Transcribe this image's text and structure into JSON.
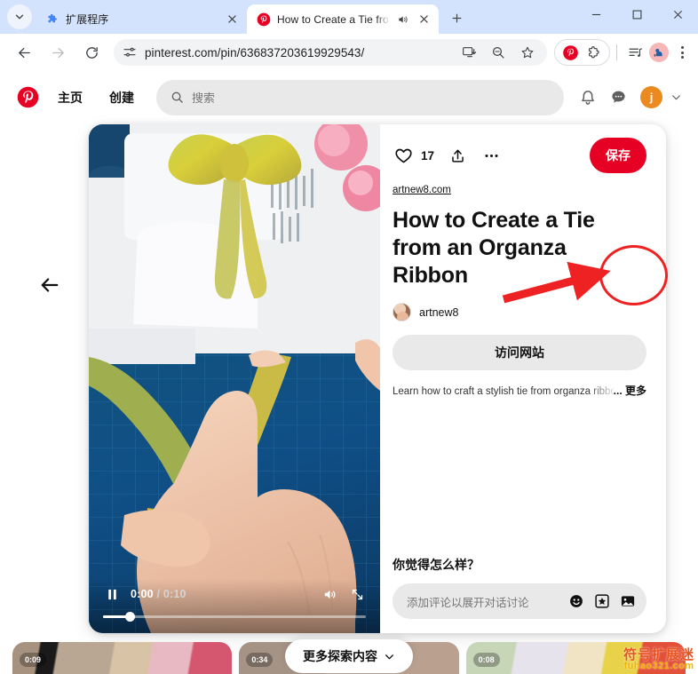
{
  "browser": {
    "tabs": [
      {
        "title": "扩展程序",
        "favicon": "puzzle-icon",
        "active": false,
        "audio": false
      },
      {
        "title": "How to Create a Tie from",
        "favicon": "pinterest-icon",
        "active": true,
        "audio": true
      }
    ],
    "new_tab_label": "+",
    "url": "pinterest.com/pin/636837203619929543/",
    "nav": {
      "back": "back-arrow-icon",
      "forward": "forward-arrow-icon",
      "reload": "reload-icon"
    },
    "omnibox_icons": [
      "site-settings-icon",
      "install-app-icon",
      "zoom-icon",
      "bookmark-star-icon"
    ],
    "extensions": [
      "pinterest-extension-icon",
      "extensions-puzzle-icon"
    ],
    "toolbar_icons": [
      "reading-list-icon",
      "profile-avatar-icon",
      "chrome-menu-icon"
    ],
    "window_controls": [
      "minimize",
      "maximize",
      "close"
    ]
  },
  "pinterest": {
    "logo": "pinterest-logo-icon",
    "nav": [
      {
        "label": "主页"
      },
      {
        "label": "创建"
      }
    ],
    "search": {
      "placeholder": "搜索",
      "icon": "search-icon"
    },
    "header_icons": [
      "notifications-bell-icon",
      "messages-icon"
    ],
    "account": {
      "initial": "j",
      "color": "#eb8a1e"
    },
    "back_arrow": "back-arrow-icon"
  },
  "pin": {
    "like_count": "17",
    "actions": [
      "heart-icon",
      "share-icon",
      "more-options-icon"
    ],
    "save_label": "保存",
    "save_color": "#e60023",
    "source_domain": "artnew8.com",
    "title": "How to Create a Tie from an Organza Ribbon",
    "author": "artnew8",
    "visit_label": "访问网站",
    "description": "Learn how to craft a stylish tie from organza ribbon! F",
    "more_label": "... 更多",
    "comment_heading": "你觉得怎么样？",
    "comment_placeholder": "添加评论以展开对话讨论",
    "comment_icons": [
      "emoji-icon",
      "sticker-icon",
      "image-icon"
    ]
  },
  "video": {
    "state": "paused",
    "play_pause_icon": "pause-icon",
    "current_time": "0:00",
    "separator": "/",
    "duration": "0:10",
    "volume_icon": "volume-on-icon",
    "fullscreen_icon": "expand-icon",
    "progress_percent": 10
  },
  "explore": {
    "button_label": "更多探索内容",
    "chevron": "chevron-down-icon",
    "thumbnails": [
      {
        "duration": "0:09"
      },
      {
        "duration": "0:34"
      },
      {
        "duration": "0:08"
      }
    ]
  },
  "annotation": {
    "highlight_color": "#ee2222",
    "target": "save-button"
  },
  "watermark": {
    "cn": "符号扩展迷",
    "en": "fuhao321.com"
  }
}
